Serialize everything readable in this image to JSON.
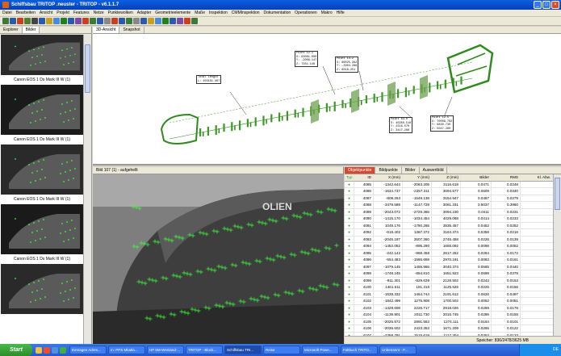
{
  "window": {
    "title": "Schiffsbau TRITOP .neuster - TRITOP - v6.1.1.7",
    "controls": [
      "_",
      "□",
      "×"
    ]
  },
  "menu": [
    "Datei",
    "Bearbeiten",
    "Ansicht",
    "Projekt",
    "Features",
    "Netze",
    "Punktewolken",
    "Adapter",
    "Geometrieelemente",
    "Maße",
    "Inspektion",
    "CMMInspektion",
    "Dokumentation",
    "Operationen",
    "Makro",
    "Hilfe"
  ],
  "left_panel": {
    "tabs": [
      "Explorer",
      "Bilder"
    ],
    "thumbnails": [
      {
        "label": ""
      },
      {
        "label": "Canon EOS 1 Ds Mark III W (1)"
      },
      {
        "label": "Canon EOS 1 Ds Mark III W (1)"
      },
      {
        "label": "Canon EOS 1 Ds Mark III W (1)"
      },
      {
        "label": "Canon EOS 1 Ds Mark III W (1)"
      }
    ]
  },
  "view3d": {
    "tabs": [
      "3D-Ansicht",
      "Snapshot"
    ],
    "tags": [
      {
        "lines": [
          "Total Length",
          "L: 103151.467"
        ]
      },
      {
        "lines": [
          "Point 12-1",
          "X: 63081.000",
          "Y: -2006.147",
          "Z: 7351.148"
        ]
      },
      {
        "lines": [
          "Point 14-2",
          "X: 80025.362",
          "Y: -2904.289",
          "Z: 6018.251"
        ]
      },
      {
        "lines": [
          "Point 63-0",
          "X: 45950.510",
          "Y: 2316.570",
          "Z: 3417.280"
        ]
      },
      {
        "lines": [
          "Point 12-5",
          "X: 70008.792",
          "Y: 6830.730",
          "Z: 5047.280"
        ]
      }
    ]
  },
  "photo_panel": {
    "title": "Bild 107 (1) - aufgehellt",
    "hull_text": "OLIEN"
  },
  "table_panel": {
    "tabs": [
      "Objektpunkte",
      "Bildpunkte",
      "Bilder",
      "Auswertbild"
    ],
    "headers": [
      "Typ",
      "ID",
      "X (mm)",
      "Y (mm)",
      "Z (mm)",
      "Bilder",
      "RMS",
      "Kl. Abw."
    ],
    "rows": [
      [
        "4085",
        "-1342.644",
        "-2063.205",
        "3116.618",
        "0.0471",
        "0.0248"
      ],
      [
        "4086",
        "-1634.737",
        "-2257.311",
        "3094.577",
        "0.0609",
        "0.0340"
      ],
      [
        "4087",
        "-808.263",
        "-1549.138",
        "3154.947",
        "0.0467",
        "0.0279"
      ],
      [
        "4088",
        "-3479.589",
        "-1147.729",
        "3061.331",
        "0.5037",
        "0.3960"
      ],
      [
        "4089",
        "-2043.072",
        "-2729.366",
        "3094.230",
        "0.0411",
        "0.0231"
      ],
      [
        "4090",
        "-1415.170",
        "-1034.454",
        "4029.068",
        "0.0414",
        "0.0233"
      ],
      [
        "4091",
        "1049.176",
        "-1790.265",
        "3535.457",
        "0.0452",
        "0.0252"
      ],
      [
        "4092",
        "-619.402",
        "1387.372",
        "3164.374",
        "0.0358",
        "0.0216"
      ],
      [
        "4093",
        "-2045.187",
        "2607.360",
        "2745.458",
        "0.0226",
        "0.0139"
      ],
      [
        "4094",
        "-1452.052",
        "-895.290",
        "1655.092",
        "0.0096",
        "0.0052"
      ],
      [
        "4095",
        "-242.142",
        "-968.458",
        "2617.252",
        "0.0284",
        "0.0172"
      ],
      [
        "4096",
        "-554.483",
        "-1595.659",
        "2970.191",
        "0.0083",
        "0.0161"
      ],
      [
        "4097",
        "-1079.145",
        "1455.966",
        "3040.374",
        "0.0565",
        "0.0440"
      ],
      [
        "4098",
        "-1748.245",
        "-854.810",
        "1651.923",
        "0.0598",
        "0.0378"
      ],
      [
        "4099",
        "-911.301",
        "-929.639",
        "2128.502",
        "0.0243",
        "0.0153"
      ],
      [
        "4100",
        "1461.611",
        "181.316",
        "1125.526",
        "0.0225",
        "0.0156"
      ],
      [
        "4101",
        "-1639.332",
        "1464.744",
        "2191.612",
        "0.0626",
        "0.0497"
      ],
      [
        "4102",
        "-1842.499",
        "1275.908",
        "1700.502",
        "0.0052",
        "0.0051"
      ],
      [
        "4103",
        "-1428.608",
        "2226.717",
        "2918.026",
        "0.0269",
        "0.0178"
      ],
      [
        "4104",
        "-1139.901",
        "2011.730",
        "2015.745",
        "0.0295",
        "0.0158"
      ],
      [
        "4105",
        "-2026.572",
        "2891.563",
        "1274.111",
        "0.0164",
        "0.0101"
      ],
      [
        "4106",
        "-2036.602",
        "2423.353",
        "1671.209",
        "0.0265",
        "0.0122"
      ],
      [
        "4107",
        "-2358.791",
        "1515.619",
        "1117.304",
        "0.0352",
        "0.0133"
      ]
    ],
    "status": "Speicher: 836/2478/3625 MB"
  },
  "taskbar": {
    "start_label": "Start",
    "tasks": [
      "Eintragen Adres...",
      "In: PPS Mkatla...",
      "HP 5M-Wenland-...",
      "TRITOP - Block...",
      "Schiffsbau TRI...",
      "Reise",
      "Microsoft Powe...",
      "Faltbuch TRITO...",
      "Unbenannt - P..."
    ],
    "tray_text": "DE"
  },
  "colors": {
    "accent_title": "#0a5fe0",
    "ship_green": "#2f8a1e",
    "marker_green": "#3cff3c",
    "active_tab": "#d44a30"
  }
}
